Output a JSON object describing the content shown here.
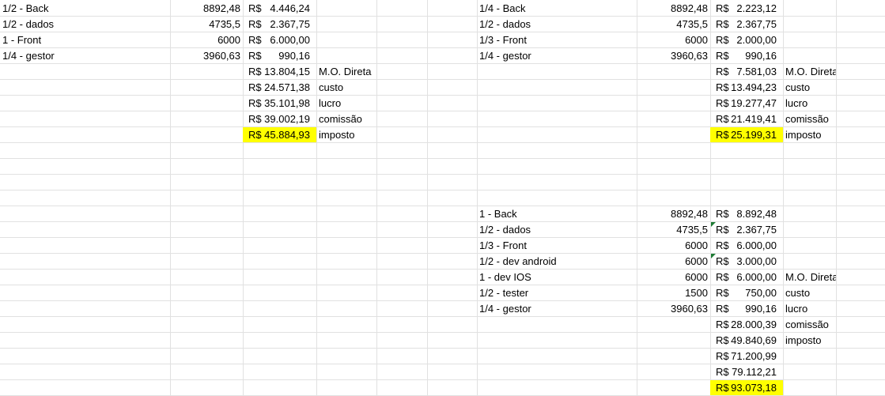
{
  "sheet": {
    "top_left": {
      "roles": [
        {
          "label": "1/2 - Back",
          "value": "8892,48",
          "cost": "4.446,24"
        },
        {
          "label": "1/2 - dados",
          "value": "4735,5",
          "cost": "2.367,75"
        },
        {
          "label": "1 - Front",
          "value": "6000",
          "cost": "6.000,00"
        },
        {
          "label": "1/4 - gestor",
          "value": "3960,63",
          "cost": "990,16"
        }
      ],
      "totals": [
        {
          "amount": "13.804,15",
          "label": "M.O. Direta"
        },
        {
          "amount": "24.571,38",
          "label": "custo"
        },
        {
          "amount": "35.101,98",
          "label": "lucro"
        },
        {
          "amount": "39.002,19",
          "label": "comissão"
        },
        {
          "amount": "45.884,93",
          "label": "imposto",
          "highlight": true
        }
      ]
    },
    "top_right": {
      "roles": [
        {
          "label": "1/4 - Back",
          "value": "8892,48",
          "cost": "2.223,12"
        },
        {
          "label": "1/2 - dados",
          "value": "4735,5",
          "cost": "2.367,75"
        },
        {
          "label": "1/3 - Front",
          "value": "6000",
          "cost": "2.000,00"
        },
        {
          "label": "1/4 - gestor",
          "value": "3960,63",
          "cost": "990,16"
        }
      ],
      "totals": [
        {
          "amount": "7.581,03",
          "label": "M.O. Direta"
        },
        {
          "amount": "13.494,23",
          "label": "custo"
        },
        {
          "amount": "19.277,47",
          "label": "lucro"
        },
        {
          "amount": "21.419,41",
          "label": "comissão"
        },
        {
          "amount": "25.199,31",
          "label": "imposto",
          "highlight": true
        }
      ]
    },
    "bottom_right": {
      "roles": [
        {
          "label": "1 - Back",
          "value": "8892,48",
          "cost": "8.892,48"
        },
        {
          "label": "1/2 - dados",
          "value": "4735,5",
          "cost": "2.367,75",
          "note": true
        },
        {
          "label": "1/3 - Front",
          "value": "6000",
          "cost": "6.000,00"
        },
        {
          "label": "1/2 - dev android",
          "value": "6000",
          "cost": "3.000,00",
          "note": true
        },
        {
          "label": "1 - dev IOS",
          "value": "6000",
          "cost": "6.000,00",
          "side": "M.O. Direta"
        },
        {
          "label": "1/2 - tester",
          "value": "1500",
          "cost": "750,00",
          "side": "custo"
        },
        {
          "label": "1/4 - gestor",
          "value": "3960,63",
          "cost": "990,16",
          "side": "lucro"
        }
      ],
      "totals": [
        {
          "amount": "28.000,39",
          "label": "comissão"
        },
        {
          "amount": "49.840,69",
          "label": "imposto"
        },
        {
          "amount": "71.200,99"
        },
        {
          "amount": "79.112,21"
        },
        {
          "amount": "93.073,18",
          "highlight": true
        }
      ]
    },
    "currency_symbol": "R$",
    "colors": {
      "highlight": "#ffff00",
      "gridline": "#e1e1e1",
      "comment_marker": "#1e7b34"
    }
  }
}
